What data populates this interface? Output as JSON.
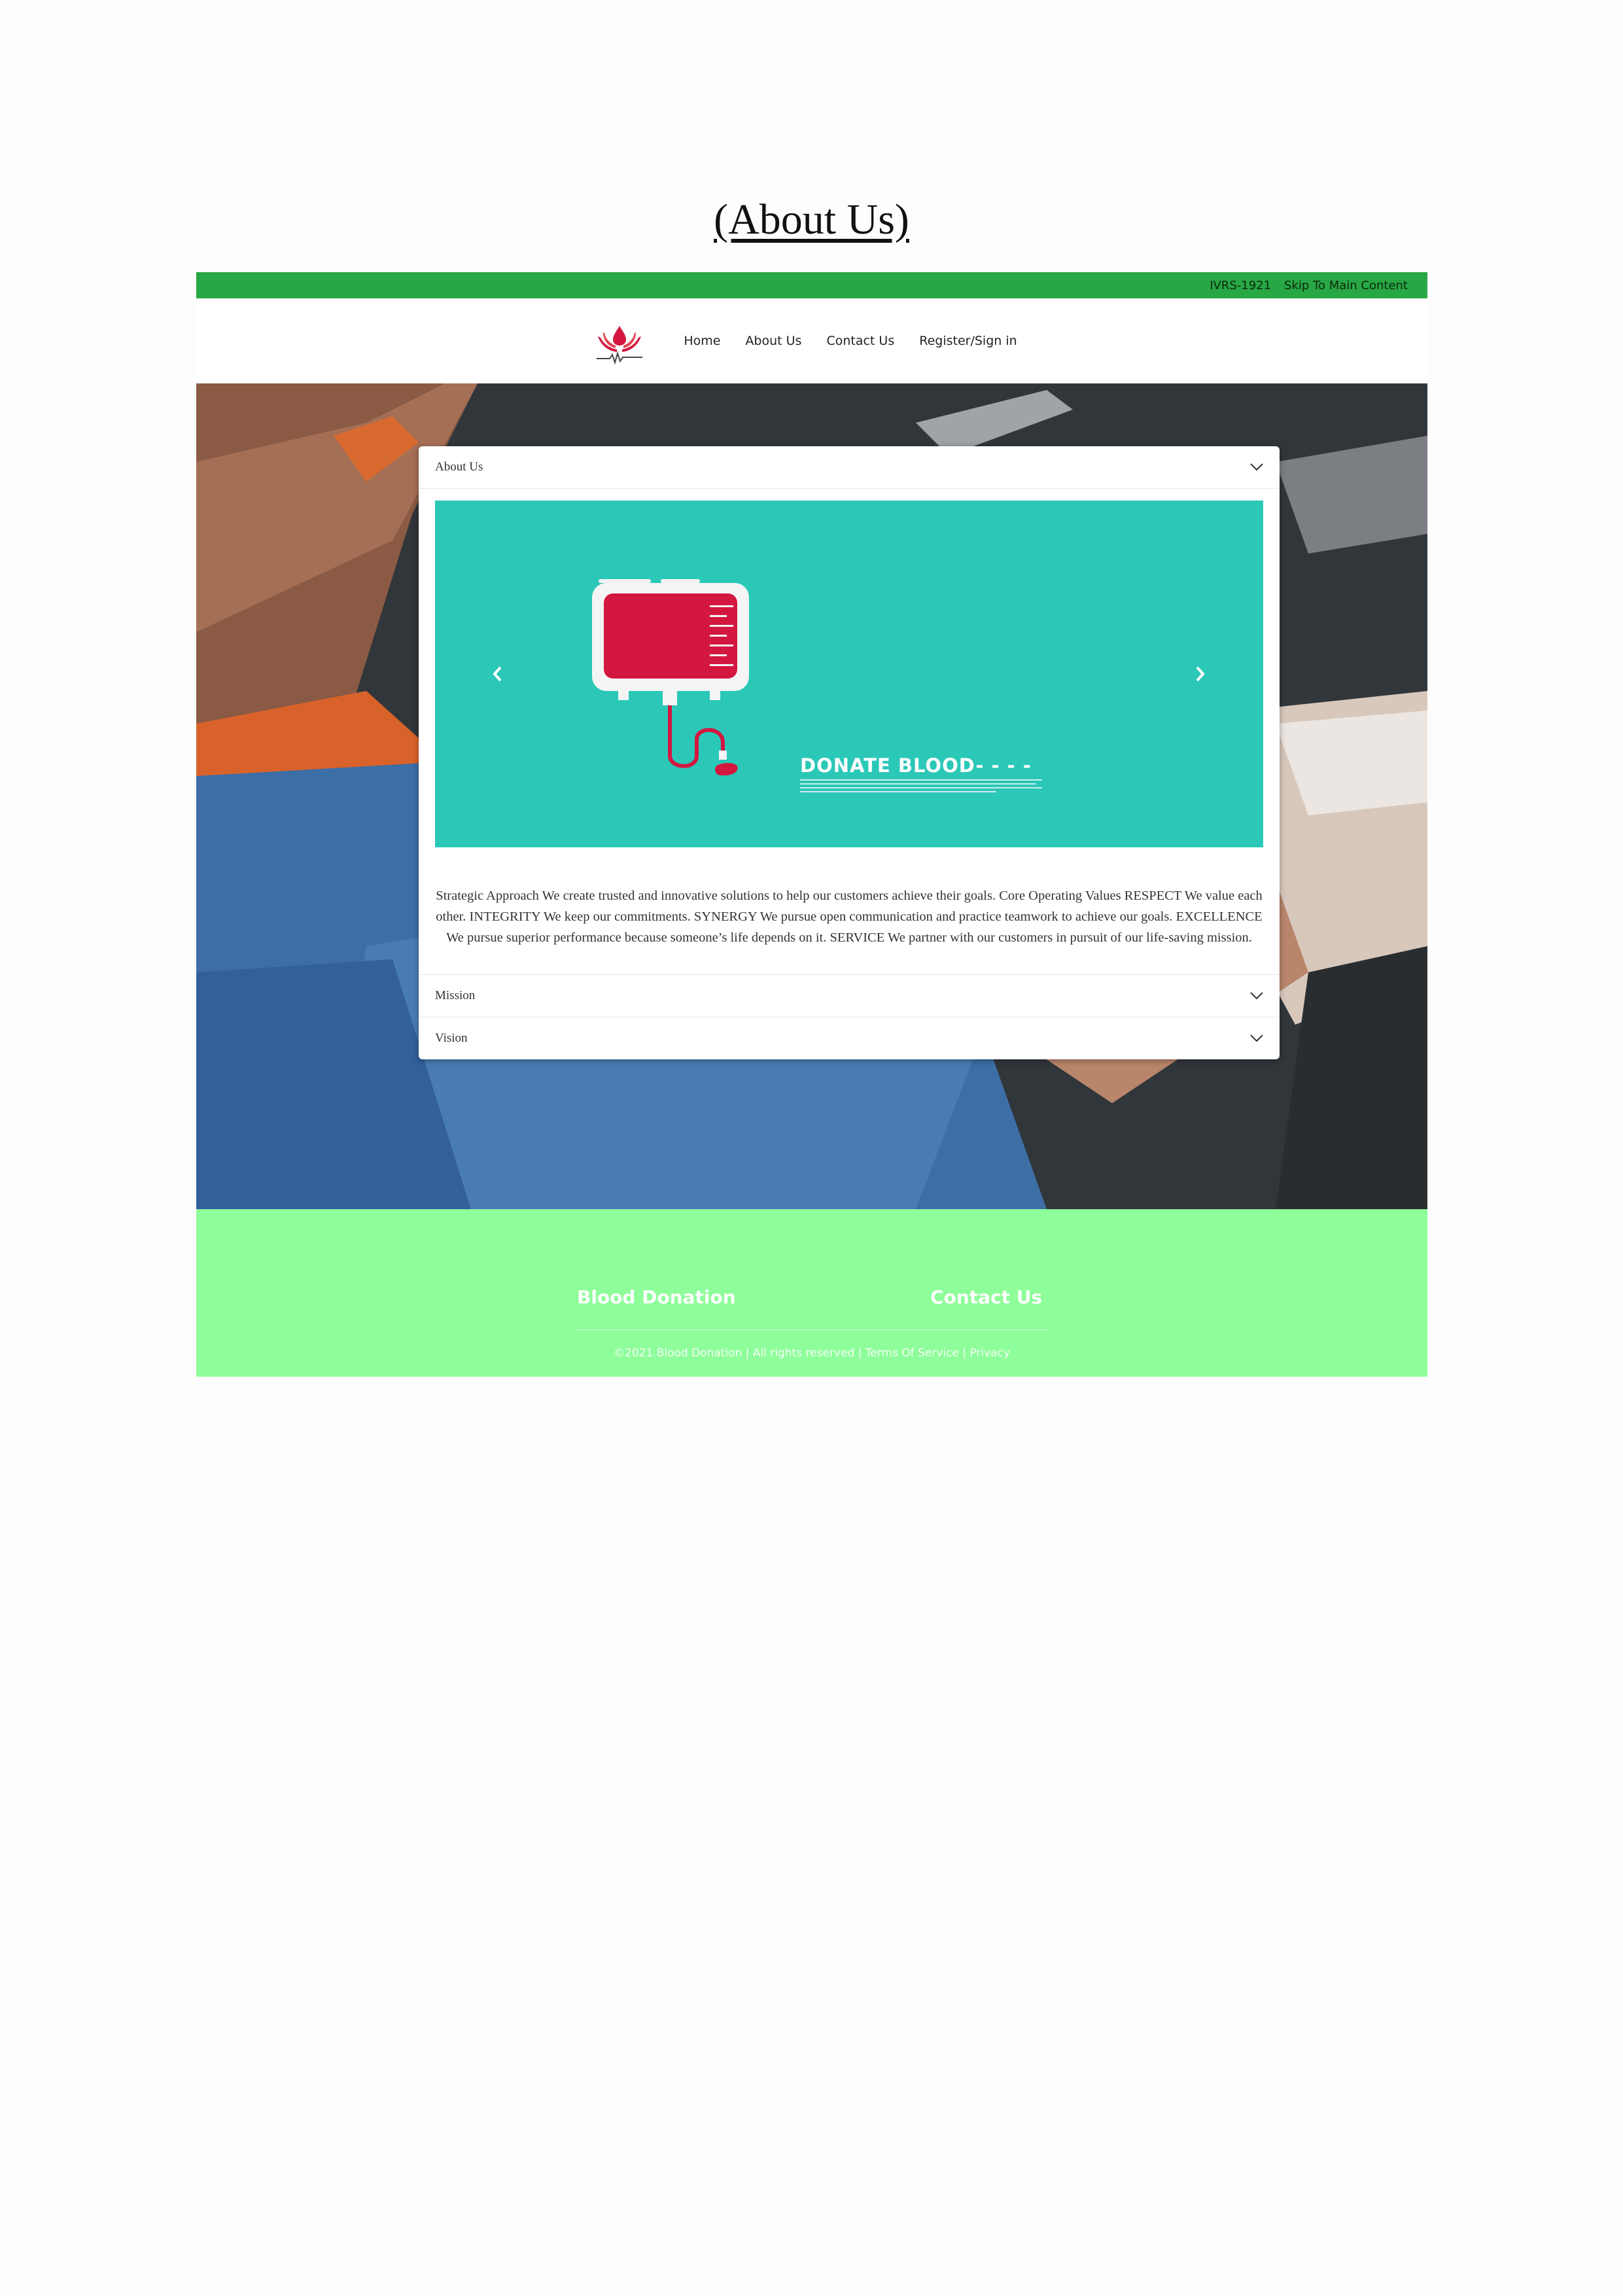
{
  "document": {
    "title": "(About Us)"
  },
  "topbar": {
    "ivrs": "IVRS-1921",
    "skip_link": "Skip To Main Content"
  },
  "nav": {
    "logo_icon": "blood-drop-hands-logo",
    "links": [
      "Home",
      "About Us",
      "Contact Us",
      "Register/Sign in"
    ]
  },
  "accordion": {
    "sections": [
      {
        "title": "About Us",
        "expanded": true,
        "text": "Strategic Approach We create trusted and innovative solutions to help our customers achieve their goals. Core Operating Values RESPECT We value each other. INTEGRITY We keep our commitments. SYNERGY We pursue open communication and practice teamwork to achieve our goals. EXCELLENCE We pursue superior performance because someone’s life depends on it. SERVICE We partner with our customers in pursuit of our life-saving mission."
      },
      {
        "title": "Mission",
        "expanded": false
      },
      {
        "title": "Vision",
        "expanded": false
      }
    ],
    "carousel": {
      "caption": "DONATE BLOOD- - - -",
      "background": "#2bc8b8",
      "prev_icon": "chevron-left-icon",
      "next_icon": "chevron-right-icon"
    }
  },
  "footer": {
    "col1": "Blood Donation",
    "col2": "Contact Us",
    "copyright": "©2021 Blood Donation | All rights reserved | ",
    "terms": "Terms Of Service",
    "separator": " | ",
    "privacy": "Privacy"
  },
  "colors": {
    "topbar": "#28a745",
    "footer": "#8efe9a",
    "accent_red": "#d3173f"
  }
}
